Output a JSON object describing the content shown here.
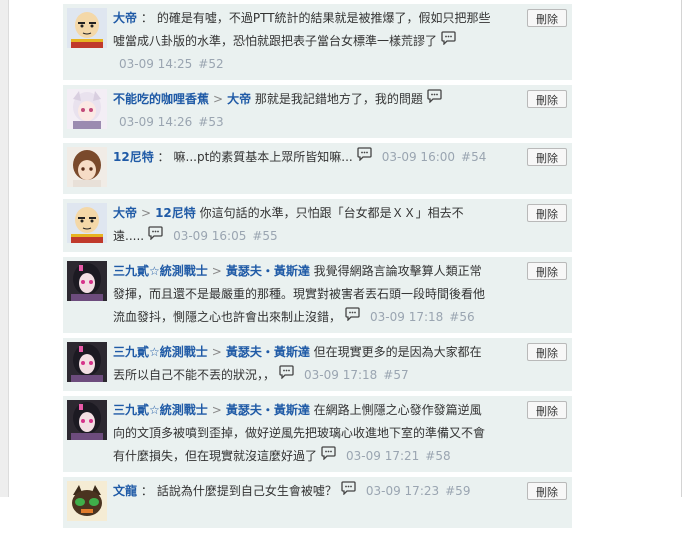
{
  "delete_label": "刪除",
  "comments": [
    {
      "user": "大帝",
      "reply_to": "",
      "text": "的確是有噓，不過PTT統計的結果就是被推爆了，假如只把那些噓當成八卦版的水準，恐怕就跟把表子當台女標準一樣荒謬了",
      "time": "03-09 14:25",
      "num": "#52",
      "avatar": "bald-hero"
    },
    {
      "user": "不能吃的咖哩香蕉",
      "reply_to": "大帝",
      "text": "那就是我記錯地方了，我的問題",
      "time": "03-09 14:26",
      "num": "#53",
      "avatar": "white-hair"
    },
    {
      "user": "12尼特",
      "reply_to": "",
      "text": "嘛...pt的素質基本上眾所皆知嘛...",
      "time": "03-09 16:00",
      "num": "#54",
      "avatar": "brown-hair"
    },
    {
      "user": "大帝",
      "reply_to": "12尼特",
      "text": "你這句話的水準，只怕跟「台女都是ＸＸ」相去不遠.....",
      "time": "03-09 16:05",
      "num": "#55",
      "avatar": "bald-hero"
    },
    {
      "user": "三九貳☆統測戰士",
      "reply_to": "黃瑟夫・黃斯達",
      "text": "我覺得網路言論攻擊算人類正常發揮，而且還不是最嚴重的那種。現實對被害者丟石頭一段時間後看他流血發抖，惻隱之心也許會出來制止沒錯，",
      "time": "03-09 17:18",
      "num": "#56",
      "avatar": "dark-girl"
    },
    {
      "user": "三九貳☆統測戰士",
      "reply_to": "黃瑟夫・黃斯達",
      "text": "但在現實更多的是因為大家都在丟所以自己不能不丟的狀況，，",
      "time": "03-09 17:18",
      "num": "#57",
      "avatar": "dark-girl"
    },
    {
      "user": "三九貳☆統測戰士",
      "reply_to": "黃瑟夫・黃斯達",
      "text": "在網路上惻隱之心發作發篇逆風向的文頂多被噴到歪掉，做好逆風先把玻璃心收進地下室的準備又不會有什麼損失，但在現實就沒這麼好過了",
      "time": "03-09 17:21",
      "num": "#58",
      "avatar": "dark-girl"
    },
    {
      "user": "文龍",
      "reply_to": "",
      "text": "話說為什麼提到自己女生會被噓？",
      "time": "03-09 17:23",
      "num": "#59",
      "avatar": "cat-mask"
    }
  ]
}
